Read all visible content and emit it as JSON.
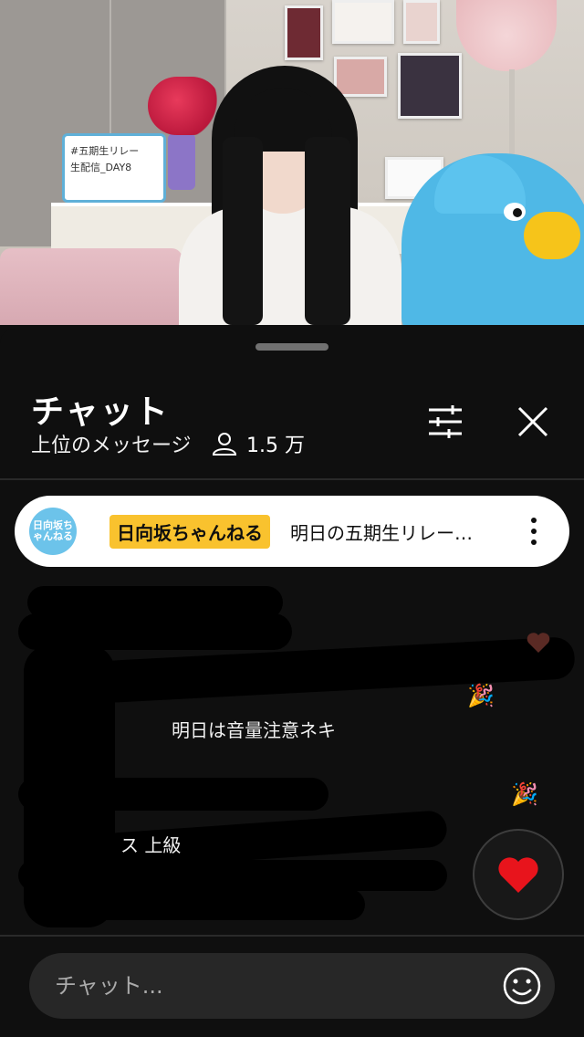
{
  "video": {
    "whiteboard_text": [
      "#五期生リレー",
      "生配信_DAY8"
    ]
  },
  "chat": {
    "title": "チャット",
    "filter_label": "上位のメッセージ",
    "viewer_count": "1.5 万",
    "pinned": {
      "avatar_text": "日向坂ちゃんねる",
      "author": "日向坂ちゃんねる",
      "message": "明日の五期生リレー…"
    },
    "visible_message": "明日は音量注意ネキ",
    "partial_text": "ス 上級"
  },
  "input": {
    "placeholder": "チャット..."
  },
  "icons": {
    "filter": "tune-icon",
    "close": "close-icon",
    "viewers": "person-icon",
    "more": "more-vert-icon",
    "reaction": "heart-icon",
    "emoji": "emoji-icon",
    "confetti": "party-popper-icon"
  },
  "colors": {
    "background": "#0f0f0f",
    "pinned_bg": "#ffffff",
    "badge": "#f9c22e",
    "heart": "#e8141c"
  }
}
